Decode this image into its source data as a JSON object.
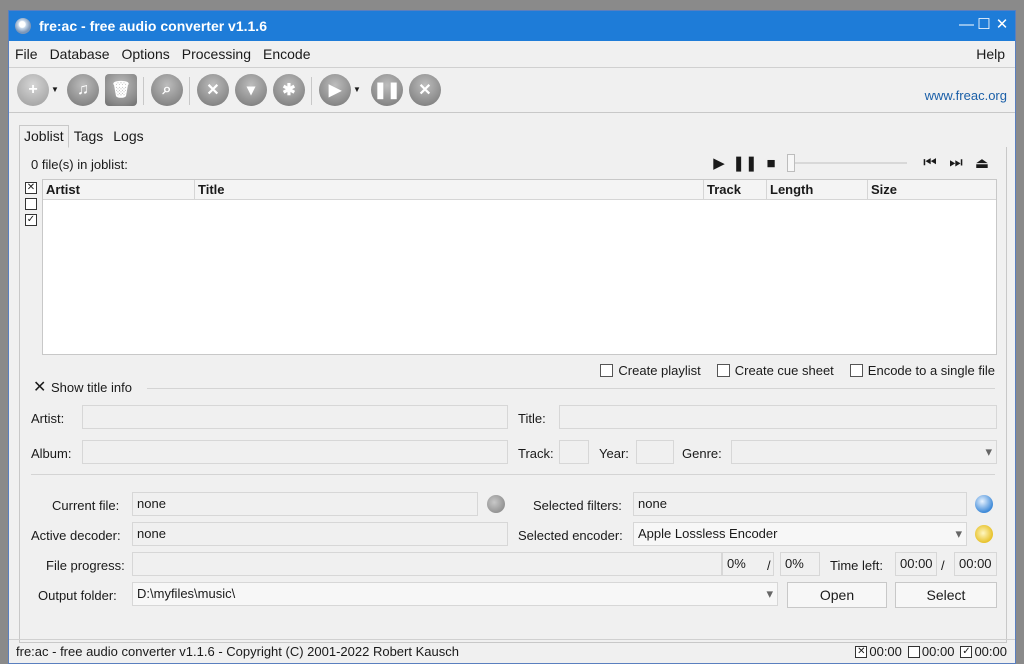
{
  "window": {
    "title": "fre:ac - free audio converter v1.1.6"
  },
  "menu": [
    "File",
    "Database",
    "Options",
    "Processing",
    "Encode"
  ],
  "menu_help": "Help",
  "toolbar": {
    "link": "www.freac.org"
  },
  "tabs": [
    "Joblist",
    "Tags",
    "Logs"
  ],
  "joblist": {
    "count_text": "0 file(s) in joblist:",
    "columns": [
      "Artist",
      "Title",
      "Track",
      "Length",
      "Size"
    ]
  },
  "options": {
    "create_playlist": "Create playlist",
    "create_cue_sheet": "Create cue sheet",
    "encode_single": "Encode to a single file"
  },
  "title_info": {
    "toggle": "Show title info",
    "artist_label": "Artist:",
    "title_label": "Title:",
    "album_label": "Album:",
    "track_label": "Track:",
    "year_label": "Year:",
    "genre_label": "Genre:"
  },
  "status_panel": {
    "current_file_label": "Current file:",
    "current_file_value": "none",
    "selected_filters_label": "Selected filters:",
    "selected_filters_value": "none",
    "active_decoder_label": "Active decoder:",
    "active_decoder_value": "none",
    "selected_encoder_label": "Selected encoder:",
    "selected_encoder_value": "Apple Lossless Encoder",
    "file_progress_label": "File progress:",
    "file_progress_pct": "0%",
    "slash": "/",
    "total_progress_pct": "0%",
    "time_left_label": "Time left:",
    "time_left_value": "00:00",
    "time_total_value": "00:00",
    "output_folder_label": "Output folder:",
    "output_folder_value": "D:\\myfiles\\music\\",
    "open_button": "Open",
    "select_button": "Select"
  },
  "statusbar": {
    "text": "fre:ac - free audio converter v1.1.6 - Copyright (C) 2001-2022 Robert Kausch",
    "t1": "00:00",
    "t2": "00:00",
    "t3": "00:00"
  },
  "colors": {
    "titlebar": "#1e7cd8",
    "link": "#1a5fa8"
  }
}
